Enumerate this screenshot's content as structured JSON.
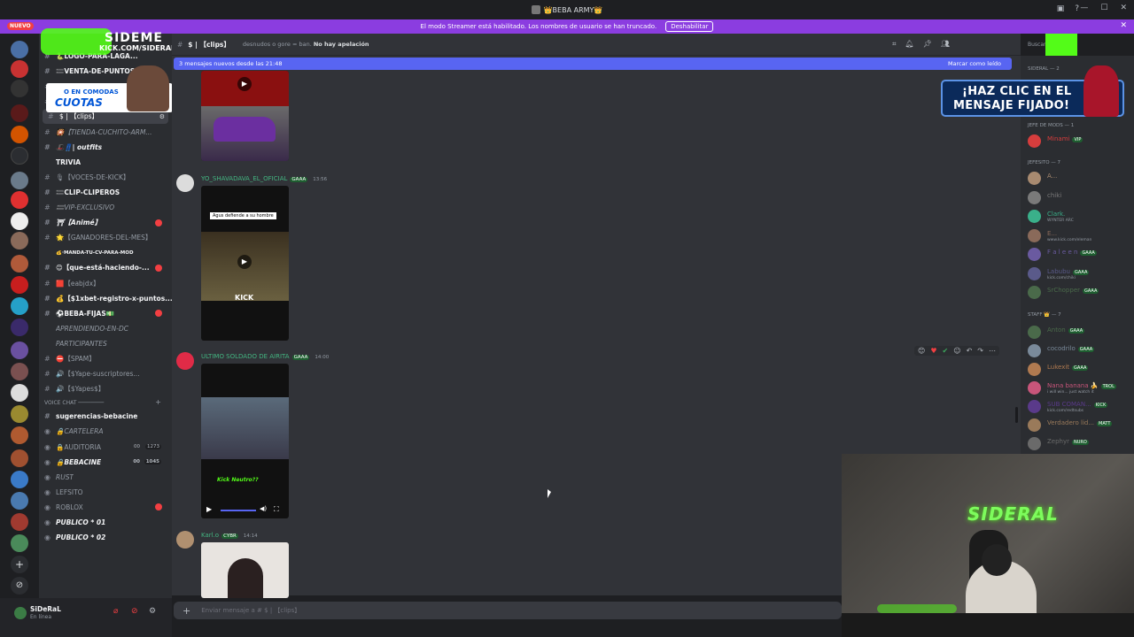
{
  "window": {
    "title": "👑BEBA ARMY👑"
  },
  "banner": {
    "badge": "NUEVO",
    "message": "El modo Streamer está habilitado. Los nombres de usuario se han truncado.",
    "button": "Deshabilitar"
  },
  "overlay": {
    "brand": "SIDEME",
    "url": "KICK.COM/SIDERAL",
    "promo_line1": "O EN COMODAS",
    "promo_line2": "CUOTAS",
    "pin_line1": "¡HAZ CLIC EN EL",
    "pin_line2": "MENSAJE FIJADO!",
    "cam_sign": "SIDERAL"
  },
  "channels": [
    {
      "label": "🐍LOGO-PARA-LAGA...",
      "style": "bold"
    },
    {
      "label": "🟰VENTA-DE-PUNTOS",
      "style": "bold"
    },
    {
      "label": "⚔ ✧Minecraft✧·",
      "style": "italic"
    },
    {
      "label": "〰【diseños】",
      "style": ""
    },
    {
      "label": "$ | 【clips】",
      "style": "active"
    },
    {
      "label": "🎇【TIENDA-CUCHITO-ARM...",
      "style": "italic"
    },
    {
      "label": "🎩👖| outfits",
      "style": "bold italic"
    },
    {
      "label": "TRIVIA",
      "style": "bold",
      "nohash": true
    },
    {
      "label": "🎙【VOCES-DE-KICK】",
      "style": ""
    },
    {
      "label": "🟰CLIP-CLIPEROS",
      "style": "bold"
    },
    {
      "label": "🟰VIP-EXCLUSIVO",
      "style": "italic"
    },
    {
      "label": "⛩【Animé】",
      "style": "bold italic",
      "badge": true
    },
    {
      "label": "🌟【GANADORES-DEL-MES】",
      "style": ""
    },
    {
      "label": "💰·MANDA-TU-CV-PARA-MOD",
      "style": "bold",
      "small": true,
      "nohash": true
    },
    {
      "label": "😊【que-está-haciendo-...",
      "style": "bold",
      "badge": true
    },
    {
      "label": "🟥【eabjdx】",
      "style": ""
    },
    {
      "label": "💰【$1xbet-registro-x-puntos...",
      "style": "bold"
    },
    {
      "label": "⚽BEBA-FIJAS💵",
      "style": "bold",
      "badge": true
    },
    {
      "label": "APRENDIENDO-EN-DC",
      "style": "italic",
      "nohash": true
    },
    {
      "label": "PARTICIPANTES",
      "style": "italic",
      "nohash": true
    },
    {
      "label": "⛔【SPAM】",
      "style": ""
    },
    {
      "label": "🔊【$Yape-suscriptores...",
      "style": ""
    },
    {
      "label": "🔊【$Yapes$】",
      "style": ""
    }
  ],
  "voice_category": "VOICE CHAT ────────",
  "voice": [
    {
      "label": "sugerencias-bebacine",
      "style": "bold"
    },
    {
      "label": "🔒CARTELERA",
      "style": "italic"
    },
    {
      "label": "🔒AUDITORIA",
      "style": "",
      "count": "1273",
      "c2": "00"
    },
    {
      "label": "🔒BEBACINE",
      "style": "bold italic",
      "count": "1045",
      "c2": "00"
    },
    {
      "label": "RUST",
      "style": "italic"
    },
    {
      "label": "LEFSITO",
      "style": ""
    },
    {
      "label": "ROBLOX",
      "style": "",
      "badge": true
    },
    {
      "label": "PUBLICO * 01",
      "style": "bold italic"
    },
    {
      "label": "PUBLICO * 02",
      "style": "bold italic"
    }
  ],
  "user": {
    "name": "SiDeRaL",
    "status": "En línea"
  },
  "header": {
    "channel": "$ | 【clips】",
    "topic": "desnudos o gore = ban. ",
    "topic_bold": "No hay apelación",
    "search_placeholder": "Buscar"
  },
  "newbar": {
    "text": "3 mensajes nuevos desde las 21:48",
    "action": "Marcar como leído"
  },
  "messages": [
    {
      "author": "YO_SHAVADAVA_EL_OFICIAL",
      "tag": "GAAA",
      "time": "13:56",
      "caption": "Agus defiende a su hombre"
    },
    {
      "author": "ULTIMO SOLDADO DE AIRITA",
      "tag": "GAAA",
      "time": "14:00",
      "caption": "Kick Neutro??"
    },
    {
      "author": "Karl.o",
      "tag": "CYBR",
      "time": "14:14"
    }
  ],
  "composer": {
    "placeholder": "Enviar mensaje a # $ | 【clips】"
  },
  "members": {
    "cat_top": "SIDERAL — 2",
    "cat_mods": "JEFE DE MODS — 1",
    "mod": {
      "name": "Minami",
      "tag": "VIP"
    },
    "cat_jefesito": "JEFESITO — 7",
    "jefesito": [
      {
        "name": "A...",
        "sub": ""
      },
      {
        "name": "chiki",
        "sub": ""
      },
      {
        "name": "Clark.",
        "sub": "WYNTER ARC"
      },
      {
        "name": "E...",
        "sub": "www.kick.com/eleman"
      },
      {
        "name": "F a l e e n",
        "tag": "GAAA",
        "sub": ""
      },
      {
        "name": "Labubu",
        "tag": "GAAA",
        "sub": "kick.com/chiki"
      },
      {
        "name": "SrChopper",
        "tag": "GAAA",
        "sub": ""
      }
    ],
    "cat_staff": "STAFF 👑 — 7",
    "staff": [
      {
        "name": "Anton",
        "tag": "GAAA",
        "sub": ""
      },
      {
        "name": "cocodrilo",
        "tag": "GAAA",
        "sub": ""
      },
      {
        "name": "Lukexit",
        "tag": "GAAA",
        "sub": ""
      },
      {
        "name": "Nana banana 🍌",
        "tag": "TROL",
        "sub": "i will win... just watch it"
      },
      {
        "name": "SUB COMAN...",
        "tag": "KICK",
        "sub": "kick.com/redtsubs"
      },
      {
        "name": "Verdadero lid...",
        "tag": "MATT",
        "sub": ""
      },
      {
        "name": "Zephyr",
        "tag": "NURO",
        "sub": ""
      }
    ]
  },
  "colors": {
    "accent": "#5865f2",
    "kick_green": "#53fc18",
    "banner": "#8b3de0",
    "badge_red": "#f23f42"
  }
}
